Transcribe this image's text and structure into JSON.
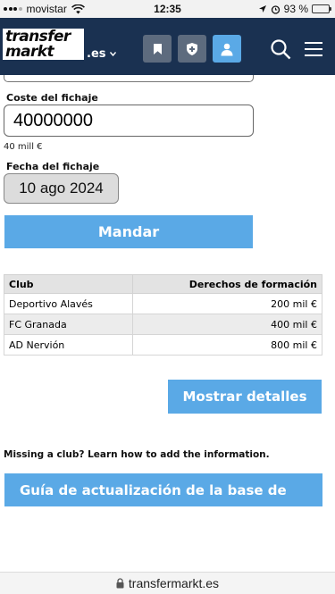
{
  "status_bar": {
    "carrier": "movistar",
    "time": "12:35",
    "battery_percent": "93 %",
    "battery_level": 0.93
  },
  "header": {
    "logo_line1": "transfer",
    "logo_line2": "markt",
    "domain": ".es",
    "accent_color": "#5aa9e6",
    "header_color": "#1a3151"
  },
  "form": {
    "fee_label": "Coste del fichaje",
    "fee_value": "40000000",
    "fee_hint": "40 mill €",
    "date_label": "Fecha del fichaje",
    "date_value": "10 ago 2024",
    "submit_label": "Mandar"
  },
  "table": {
    "headers": [
      "Club",
      "Derechos de formación"
    ],
    "rows": [
      {
        "club": "Deportivo Alavés",
        "amount": "200 mil €"
      },
      {
        "club": "FC Granada",
        "amount": "400 mil €"
      },
      {
        "club": "AD Nervión",
        "amount": "800 mil €"
      }
    ]
  },
  "details_button": "Mostrar detalles",
  "missing_text": "Missing a club? Learn how to add the information.",
  "guide_banner": "Guía de actualización de la base de",
  "url_bar": {
    "url": "transfermarkt.es"
  }
}
